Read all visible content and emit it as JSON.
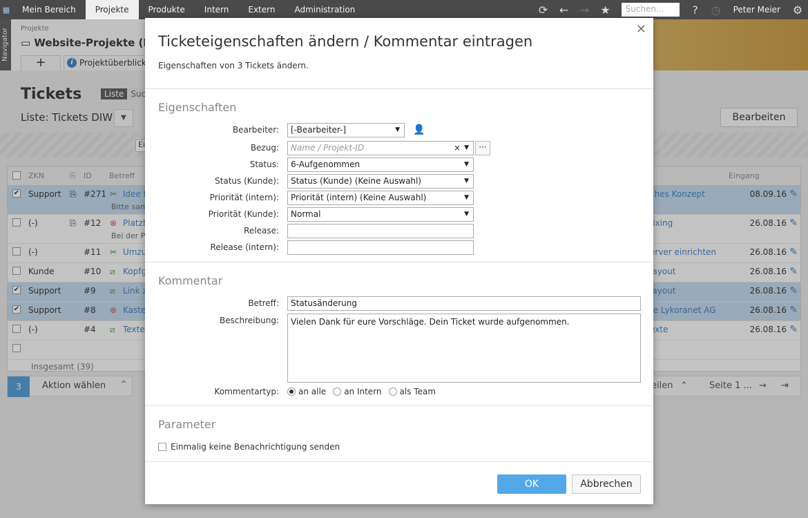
{
  "nav": {
    "tabs": [
      "Mein Bereich",
      "Projekte",
      "Produkte",
      "Intern",
      "Extern",
      "Administration"
    ],
    "search_placeholder": "Suchen...",
    "help": "?",
    "user": "Peter Meier"
  },
  "navigator": {
    "label": "Navigator"
  },
  "project": {
    "crumb": "Projekte",
    "title": "Website-Projekte (Proj",
    "add": "+",
    "tab": "Projektüberblick",
    "info": "i"
  },
  "page": {
    "title": "Tickets",
    "view_tabs": [
      "Liste",
      "Suc"
    ],
    "list_label": "Liste: Tickets DIW",
    "edit_button": "Bearbeiten",
    "filter_box": "Ei"
  },
  "table": {
    "headers": {
      "zkn": "ZKN",
      "id": "ID",
      "betreff": "Betreff",
      "eingang": "Eingang"
    },
    "rows": [
      {
        "checked": true,
        "zkn": "Support",
        "attach": true,
        "id": "#271",
        "betreff": "Idee f",
        "sub": "Bitte samm",
        "right": "ches Konzept",
        "date": "08.09.16"
      },
      {
        "checked": false,
        "zkn": "(-)",
        "attach": true,
        "id": "#12",
        "betreff": "Platzh",
        "sub": "Bei der Pr",
        "right": "fixing",
        "date": "26.08.16"
      },
      {
        "checked": false,
        "zkn": "(-)",
        "attach": false,
        "id": "#11",
        "betreff": "Umzu",
        "sub": "",
        "right": "erver einrichten",
        "date": "26.08.16"
      },
      {
        "checked": false,
        "zkn": "Kunde",
        "attach": false,
        "id": "#10",
        "betreff": "Kopfg",
        "sub": "",
        "right": "layout",
        "date": "26.08.16"
      },
      {
        "checked": true,
        "zkn": "Support",
        "attach": false,
        "id": "#9",
        "betreff": "Link z",
        "sub": "",
        "right": "layout",
        "date": "26.08.16"
      },
      {
        "checked": true,
        "zkn": "Support",
        "attach": false,
        "id": "#8",
        "betreff": "Kaster",
        "sub": "",
        "right": "te Lykoranet AG",
        "date": "26.08.16"
      },
      {
        "checked": false,
        "zkn": "(-)",
        "attach": false,
        "id": "#4",
        "betreff": "Texte",
        "sub": "",
        "right": "exte",
        "date": "26.08.16"
      }
    ],
    "total": "Insgesamt (39)"
  },
  "action_bar": {
    "count": "3",
    "label": "Aktion wählen"
  },
  "pager": {
    "share": "eilen",
    "page": "Seite 1 ..."
  },
  "modal": {
    "title": "Ticketeigenschaften ändern / Kommentar eintragen",
    "subtitle": "Eigenschaften von 3 Tickets ändern.",
    "section_props": "Eigenschaften",
    "fields": {
      "bearbeiter": {
        "label": "Bearbeiter:",
        "value": "[-Bearbeiter-]"
      },
      "bezug": {
        "label": "Bezug:",
        "placeholder": "Name / Projekt-ID"
      },
      "status": {
        "label": "Status:",
        "value": "6-Aufgenommen"
      },
      "status_kunde": {
        "label": "Status (Kunde):",
        "value": "Status (Kunde) (Keine Auswahl)"
      },
      "prio_intern": {
        "label": "Priorität (intern):",
        "value": "Priorität (intern) (Keine Auswahl)"
      },
      "prio_kunde": {
        "label": "Priorität (Kunde):",
        "value": "Normal"
      },
      "release": {
        "label": "Release:",
        "value": ""
      },
      "release_intern": {
        "label": "Release (intern):",
        "value": ""
      }
    },
    "section_comment": "Kommentar",
    "betreff": {
      "label": "Betreff:",
      "value": "Statusänderung"
    },
    "beschreibung": {
      "label": "Beschreibung:",
      "value": "Vielen Dank für eure Vorschläge. Dein Ticket wurde aufgenommen."
    },
    "kommentartyp": {
      "label": "Kommentartyp:",
      "options": [
        "an alle",
        "an Intern",
        "als Team"
      ],
      "selected": 0
    },
    "section_params": "Parameter",
    "no_notify": "Einmalig keine Benachrichtigung senden",
    "ok": "OK",
    "cancel": "Abbrechen"
  }
}
